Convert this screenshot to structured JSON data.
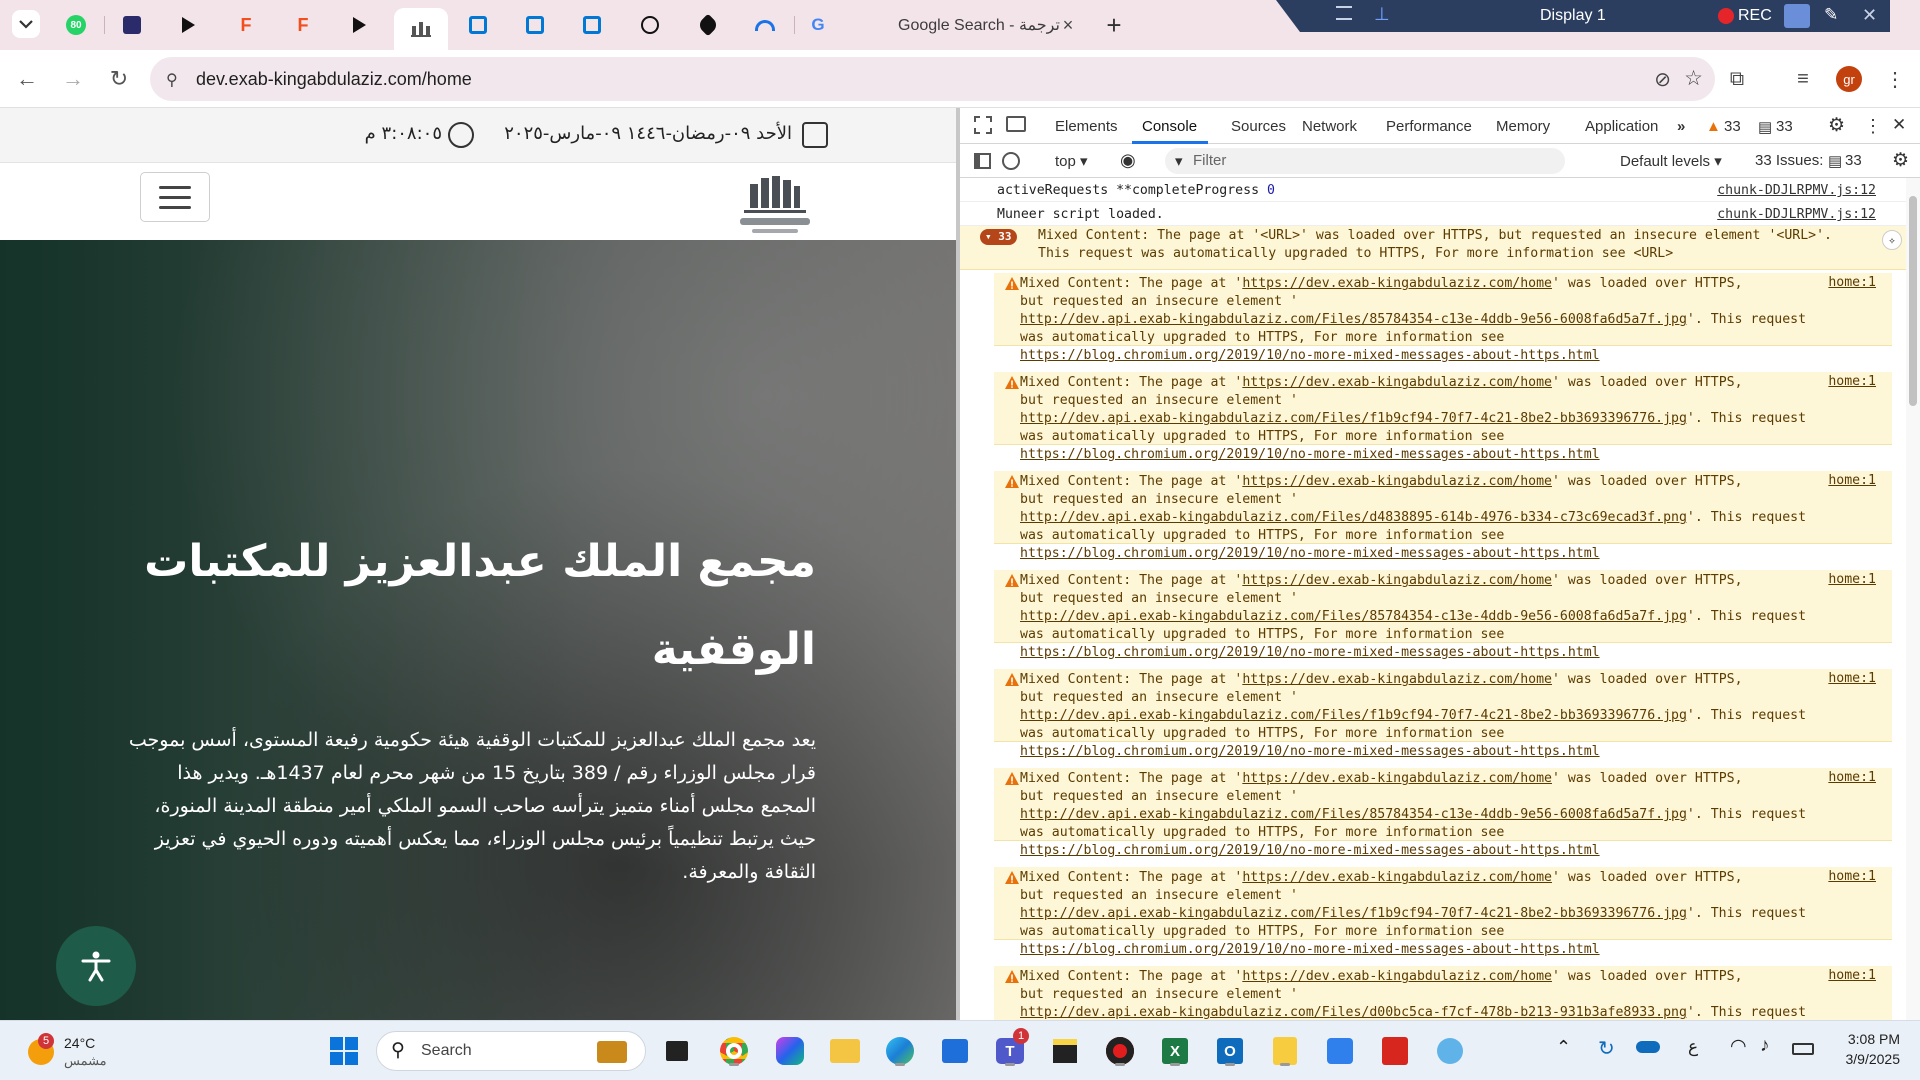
{
  "browser": {
    "active_tab_title": "Google Search - ترجمة",
    "tab_count_badge": "80",
    "url": "dev.exab-kingabdulaziz.com/home",
    "profile_initials": "gr",
    "screen_recorder": {
      "display": "Display 1",
      "rec": "REC"
    }
  },
  "site": {
    "date_line": "الأحد ٠٩-رمضان-١٤٤٦ ٠٩-مارس-٢٠٢٥",
    "time_line": "٣:٠٨:٠٥ م",
    "hero_title": "مجمع الملك عبدالعزيز للمكتبات الوقفية",
    "hero_body": "يعد مجمع الملك عبدالعزيز للمكتبات الوقفية هيئة حكومية رفيعة المستوى، أسس بموجب قرار مجلس الوزراء رقم / 389 بتاريخ 15 من شهر محرم لعام 1437هـ. ويدير هذا المجمع مجلس أمناء متميز يترأسه صاحب السمو الملكي أمير منطقة المدينة المنورة، حيث يرتبط تنظيمياً برئيس مجلس الوزراء، مما يعكس أهميته ودوره الحيوي في تعزيز الثقافة والمعرفة.",
    "accent": "#1e5b48"
  },
  "devtools": {
    "tabs": [
      "Elements",
      "Console",
      "Sources",
      "Network",
      "Performance",
      "Memory",
      "Application"
    ],
    "active_tab": "Console",
    "warnings_count": "33",
    "messages_count": "33",
    "context": "top",
    "filter_placeholder": "Filter",
    "levels": "Default levels",
    "issues_label": "33 Issues:",
    "issues_count": "33",
    "logs": [
      {
        "text": "activeRequests **completeProgress",
        "value": "0",
        "source": "chunk-DDJLRPMV.js:12"
      },
      {
        "text": "Muneer script loaded.",
        "source": "chunk-DDJLRPMV.js:12"
      }
    ],
    "group": {
      "count": "33",
      "line1": "Mixed Content: The page at '<URL>' was loaded over HTTPS, but requested an insecure element '<URL>'.",
      "line2": "This request was automatically upgraded to HTTPS, For more information see <URL>"
    },
    "warning_prefix": "Mixed Content: The page at '",
    "page_url": "https://dev.exab-kingabdulaziz.com/home",
    "warning_mid": "' was loaded over HTTPS,",
    "warning_line2": "but requested an insecure element '",
    "warning_tail": "'. This request",
    "warning_line4": "was automatically upgraded to HTTPS, For more information see",
    "info_url": "https://blog.chromium.org/2019/10/no-more-mixed-messages-about-https.html",
    "warning_source": "home:1",
    "warnings": [
      {
        "asset": "http://dev.api.exab-kingabdulaziz.com/Files/85784354-c13e-4ddb-9e56-6008fa6d5a7f.jpg"
      },
      {
        "asset": "http://dev.api.exab-kingabdulaziz.com/Files/f1b9cf94-70f7-4c21-8be2-bb3693396776.jpg"
      },
      {
        "asset": "http://dev.api.exab-kingabdulaziz.com/Files/d4838895-614b-4976-b334-c73c69ecad3f.png"
      },
      {
        "asset": "http://dev.api.exab-kingabdulaziz.com/Files/85784354-c13e-4ddb-9e56-6008fa6d5a7f.jpg"
      },
      {
        "asset": "http://dev.api.exab-kingabdulaziz.com/Files/f1b9cf94-70f7-4c21-8be2-bb3693396776.jpg"
      },
      {
        "asset": "http://dev.api.exab-kingabdulaziz.com/Files/85784354-c13e-4ddb-9e56-6008fa6d5a7f.jpg"
      },
      {
        "asset": "http://dev.api.exab-kingabdulaziz.com/Files/f1b9cf94-70f7-4c21-8be2-bb3693396776.jpg"
      },
      {
        "asset": "http://dev.api.exab-kingabdulaziz.com/Files/d00bc5ca-f7cf-478b-b213-931b3afe8933.png"
      }
    ]
  },
  "taskbar": {
    "weather_temp": "24°C",
    "weather_desc": "مشمس",
    "weather_badge": "5",
    "search_placeholder": "Search",
    "teams_badge": "1",
    "lang": "ع",
    "time": "3:08 PM",
    "date": "3/9/2025"
  }
}
